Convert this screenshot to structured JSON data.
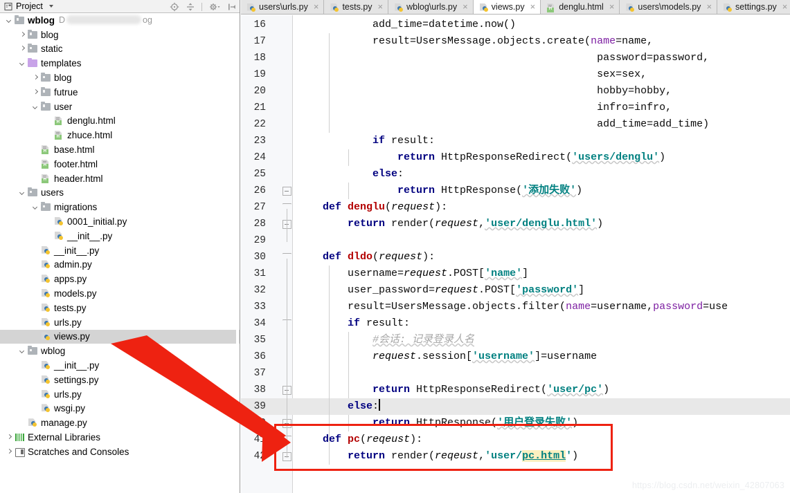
{
  "window": {
    "project_panel_title": "Project",
    "watermark": "https://blog.csdn.net/weixin_42807063"
  },
  "toolbar": {
    "icons": [
      {
        "name": "locate-icon",
        "glyph": "target"
      },
      {
        "name": "collapse-all-icon",
        "glyph": "collapse"
      },
      {
        "name": "settings-gear-icon",
        "glyph": "gear"
      },
      {
        "name": "hide-panel-icon",
        "glyph": "hide"
      }
    ]
  },
  "tree": [
    {
      "label": "wblog",
      "path_prefix": "D",
      "path_suffix": "og",
      "icon": "folder-icon",
      "depth": 0,
      "twisty": "down",
      "bold": true,
      "blurred_path": true
    },
    {
      "label": "blog",
      "icon": "folder-icon",
      "depth": 1,
      "twisty": "right"
    },
    {
      "label": "static",
      "icon": "folder-icon",
      "depth": 1,
      "twisty": "right"
    },
    {
      "label": "templates",
      "icon": "folder-purple-icon",
      "depth": 1,
      "twisty": "down"
    },
    {
      "label": "blog",
      "icon": "folder-icon",
      "depth": 2,
      "twisty": "right"
    },
    {
      "label": "futrue",
      "icon": "folder-icon",
      "depth": 2,
      "twisty": "right"
    },
    {
      "label": "user",
      "icon": "folder-icon",
      "depth": 2,
      "twisty": "down"
    },
    {
      "label": "denglu.html",
      "icon": "html-file-icon",
      "depth": 3,
      "twisty": "none"
    },
    {
      "label": "zhuce.html",
      "icon": "html-file-icon",
      "depth": 3,
      "twisty": "none"
    },
    {
      "label": "base.html",
      "icon": "html-file-icon",
      "depth": 2,
      "twisty": "none"
    },
    {
      "label": "footer.html",
      "icon": "html-file-icon",
      "depth": 2,
      "twisty": "none"
    },
    {
      "label": "header.html",
      "icon": "html-file-icon",
      "depth": 2,
      "twisty": "none"
    },
    {
      "label": "users",
      "icon": "folder-icon",
      "depth": 1,
      "twisty": "down"
    },
    {
      "label": "migrations",
      "icon": "folder-icon",
      "depth": 2,
      "twisty": "down"
    },
    {
      "label": "0001_initial.py",
      "icon": "python-file-icon",
      "depth": 3,
      "twisty": "none"
    },
    {
      "label": "__init__.py",
      "icon": "python-file-icon",
      "depth": 3,
      "twisty": "none"
    },
    {
      "label": "__init__.py",
      "icon": "python-file-icon",
      "depth": 2,
      "twisty": "none"
    },
    {
      "label": "admin.py",
      "icon": "python-file-icon",
      "depth": 2,
      "twisty": "none"
    },
    {
      "label": "apps.py",
      "icon": "python-file-icon",
      "depth": 2,
      "twisty": "none"
    },
    {
      "label": "models.py",
      "icon": "python-file-icon",
      "depth": 2,
      "twisty": "none"
    },
    {
      "label": "tests.py",
      "icon": "python-file-icon",
      "depth": 2,
      "twisty": "none"
    },
    {
      "label": "urls.py",
      "icon": "python-file-icon",
      "depth": 2,
      "twisty": "none"
    },
    {
      "label": "views.py",
      "icon": "python-file-icon",
      "depth": 2,
      "twisty": "none",
      "selected": true
    },
    {
      "label": "wblog",
      "icon": "folder-icon",
      "depth": 1,
      "twisty": "down"
    },
    {
      "label": "__init__.py",
      "icon": "python-file-icon",
      "depth": 2,
      "twisty": "none"
    },
    {
      "label": "settings.py",
      "icon": "python-file-icon",
      "depth": 2,
      "twisty": "none"
    },
    {
      "label": "urls.py",
      "icon": "python-file-icon",
      "depth": 2,
      "twisty": "none"
    },
    {
      "label": "wsgi.py",
      "icon": "python-file-icon",
      "depth": 2,
      "twisty": "none"
    },
    {
      "label": "manage.py",
      "icon": "python-file-icon",
      "depth": 1,
      "twisty": "none"
    },
    {
      "label": "External Libraries",
      "icon": "external-libraries-icon",
      "depth": 0,
      "twisty": "right"
    },
    {
      "label": "Scratches and Consoles",
      "icon": "scratches-icon",
      "depth": 0,
      "twisty": "right"
    }
  ],
  "tabs": [
    {
      "label": "users\\urls.py",
      "icon": "python-file-icon",
      "active": false,
      "closable": true
    },
    {
      "label": "tests.py",
      "icon": "python-file-icon",
      "active": false,
      "closable": true
    },
    {
      "label": "wblog\\urls.py",
      "icon": "python-file-icon",
      "active": false,
      "closable": true
    },
    {
      "label": "views.py",
      "icon": "python-file-icon",
      "active": true,
      "closable": true
    },
    {
      "label": "denglu.html",
      "icon": "html-file-icon",
      "active": false,
      "closable": true
    },
    {
      "label": "users\\models.py",
      "icon": "python-file-icon",
      "active": false,
      "closable": true
    },
    {
      "label": "settings.py",
      "icon": "python-file-icon",
      "active": false,
      "closable": true
    }
  ],
  "editor": {
    "first_line": 16,
    "caret_line": 39,
    "highlighted_lines": [
      39
    ],
    "lines": [
      {
        "n": 16,
        "text": "        add_time=datetime.now()"
      },
      {
        "n": 17,
        "text": "        result=UsersMessage.objects.create(name=name,"
      },
      {
        "n": 18,
        "text": "                                            password=password,"
      },
      {
        "n": 19,
        "text": "                                            sex=sex,"
      },
      {
        "n": 20,
        "text": "                                            hobby=hobby,"
      },
      {
        "n": 21,
        "text": "                                            infro=infro,"
      },
      {
        "n": 22,
        "text": "                                            add_time=add_time)"
      },
      {
        "n": 23,
        "text": "        if result:"
      },
      {
        "n": 24,
        "text": "            return HttpResponseRedirect('users/denglu')"
      },
      {
        "n": 25,
        "text": "        else:"
      },
      {
        "n": 26,
        "text": "            return HttpResponse('添加失败')"
      },
      {
        "n": 27,
        "text": "def denglu(request):"
      },
      {
        "n": 28,
        "text": "    return render(request,'user/denglu.html')"
      },
      {
        "n": 29,
        "text": ""
      },
      {
        "n": 30,
        "text": "def dldo(request):"
      },
      {
        "n": 31,
        "text": "    username=request.POST['name']"
      },
      {
        "n": 32,
        "text": "    user_password=request.POST['password']"
      },
      {
        "n": 33,
        "text": "    result=UsersMessage.objects.filter(name=username,password=use"
      },
      {
        "n": 34,
        "text": "    if result:"
      },
      {
        "n": 35,
        "text": "        #会话: 记录登录人名"
      },
      {
        "n": 36,
        "text": "        request.session['username']=username"
      },
      {
        "n": 37,
        "text": ""
      },
      {
        "n": 38,
        "text": "        return HttpResponseRedirect('user/pc')"
      },
      {
        "n": 39,
        "text": "    else:"
      },
      {
        "n": 40,
        "text": "        return HttpResponse('用户登录失败')"
      },
      {
        "n": 41,
        "text": "def pc(reqeust):"
      },
      {
        "n": 42,
        "text": "    return render(reqeust,'user/pc.html')"
      }
    ]
  },
  "annotations": {
    "red_box_color": "#ee2211",
    "arrow_color": "#ee2211",
    "arrow_from": "views.py tree item",
    "arrow_to": "def pc(reqeust) code block"
  }
}
